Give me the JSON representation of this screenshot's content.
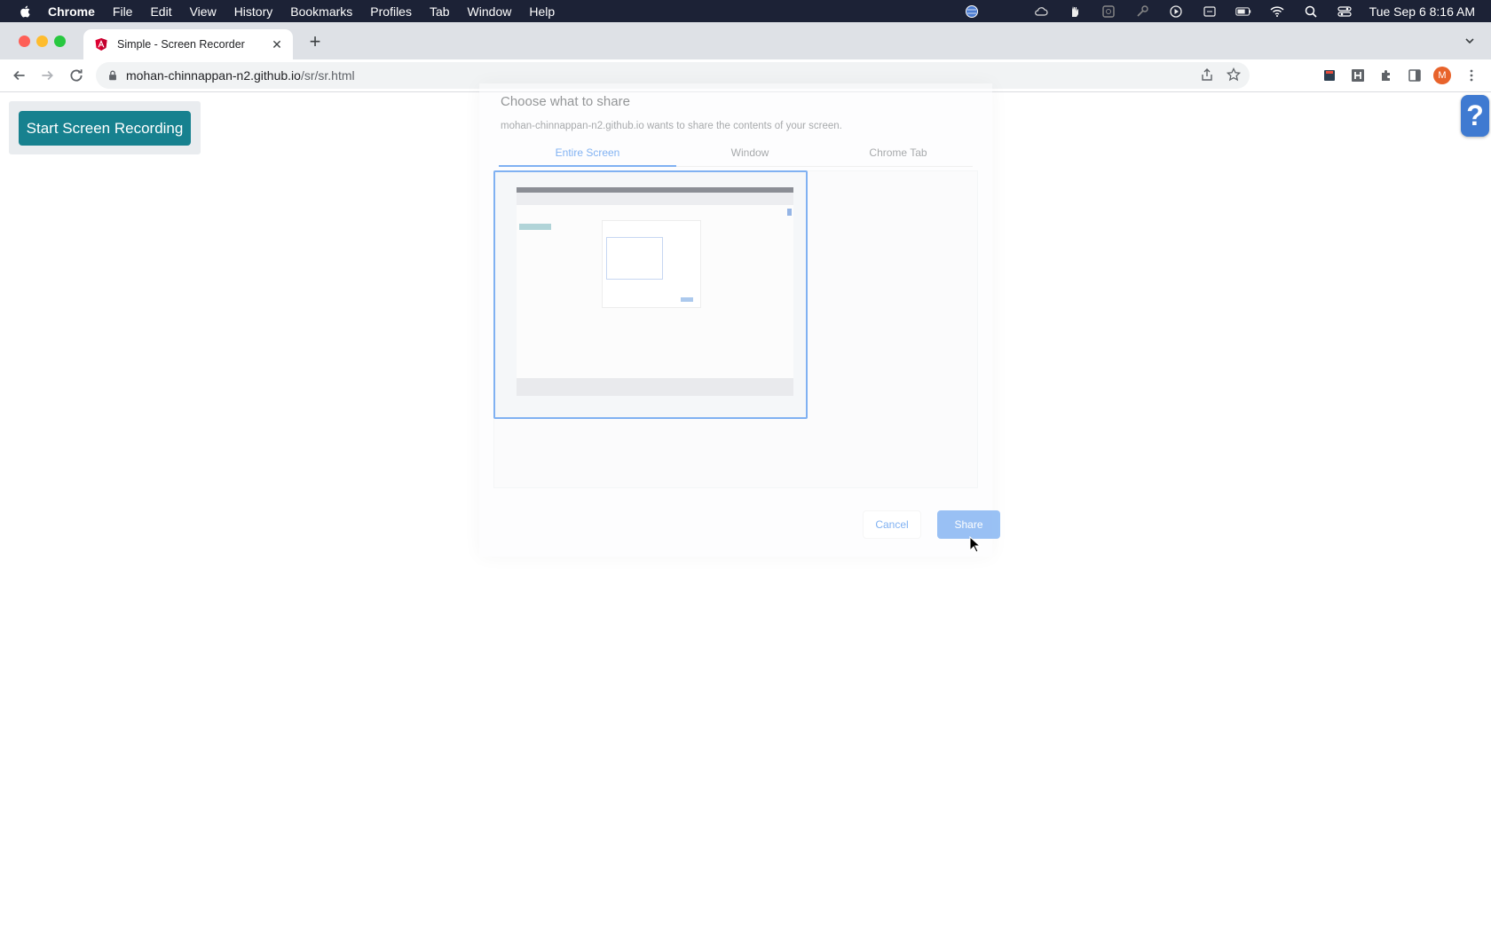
{
  "menubar": {
    "app_name": "Chrome",
    "items": [
      "File",
      "Edit",
      "View",
      "History",
      "Bookmarks",
      "Profiles",
      "Tab",
      "Window",
      "Help"
    ],
    "clock": "Tue Sep 6  8:16 AM",
    "status_icons": [
      "globe-icon",
      "cloud-icon",
      "hand-icon",
      "grammar-icon",
      "key-icon",
      "play-icon",
      "display-icon",
      "battery-icon",
      "wifi-icon",
      "search-icon",
      "control-center-icon"
    ]
  },
  "browser": {
    "tab_title": "Simple - Screen Recorder",
    "url_host": "mohan-chinnappan-n2.github.io",
    "url_path": "/sr/sr.html",
    "profile_initial": "M"
  },
  "page": {
    "record_button": "Start Screen Recording",
    "help_label": "?"
  },
  "share_dialog": {
    "title": "Choose what to share",
    "subtitle": "mohan-chinnappan-n2.github.io wants to share the contents of your screen.",
    "tabs": [
      "Entire Screen",
      "Window",
      "Chrome Tab"
    ],
    "active_tab": "Entire Screen",
    "cancel_label": "Cancel",
    "share_label": "Share"
  },
  "colors": {
    "menubar_bg": "#1c2236",
    "record_button_bg": "#17818f",
    "help_button_bg": "#3f7ad1",
    "accent": "#1a73e8"
  }
}
